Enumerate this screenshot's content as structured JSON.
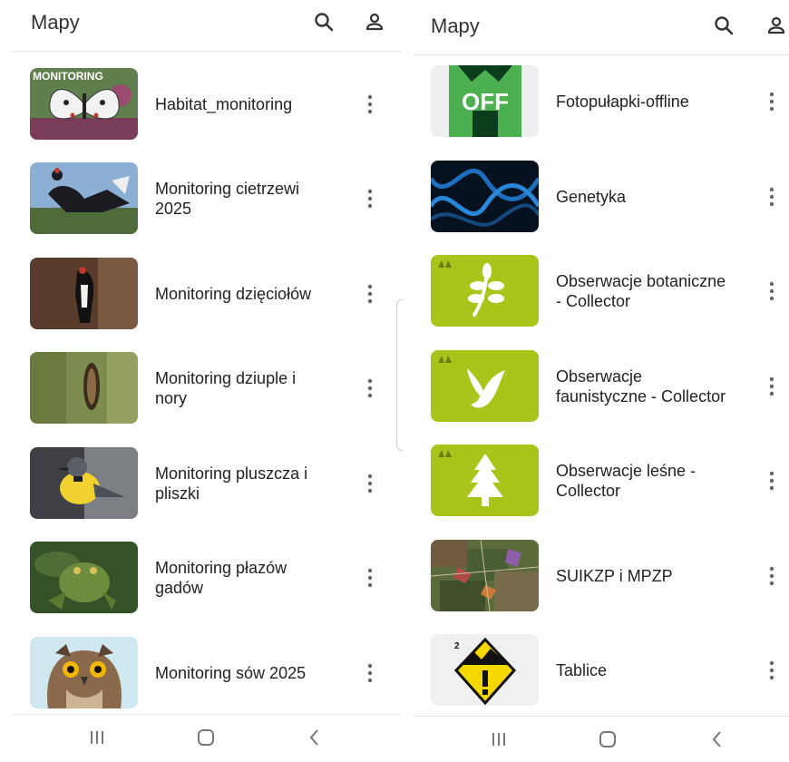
{
  "left": {
    "appbar": {
      "title": "Mapy",
      "search_icon": "search-icon",
      "account_icon": "account-icon"
    },
    "items": [
      {
        "label": "Habitat_monitoring",
        "thumb_text": "MONITORING"
      },
      {
        "label": "Monitoring cietrzewi\n2025"
      },
      {
        "label": "Monitoring dzięciołów"
      },
      {
        "label": "Monitoring dziuple i\nnory"
      },
      {
        "label": "Monitoring pluszcza i\npliszki"
      },
      {
        "label": "Monitoring płazów\ngadów"
      },
      {
        "label": "Monitoring sów 2025"
      }
    ],
    "navbar": {
      "recents_icon": "recents-icon",
      "home_icon": "home-icon",
      "back_icon": "back-icon"
    }
  },
  "right": {
    "appbar": {
      "title": "Mapy",
      "search_icon": "search-icon",
      "account_icon": "account-icon"
    },
    "items": [
      {
        "label": "Fotopułapki-offline",
        "thumb_text": "OFF"
      },
      {
        "label": "Genetyka"
      },
      {
        "label": "Obserwacje botaniczne\n- Collector"
      },
      {
        "label": "Obserwacje\nfaunistyczne - Collector"
      },
      {
        "label": "Obserwacje leśne -\nCollector"
      },
      {
        "label": "SUIKZP i MPZP"
      },
      {
        "label": "Tablice",
        "thumb_text": "2"
      }
    ],
    "navbar": {
      "recents_icon": "recents-icon",
      "home_icon": "home-icon",
      "back_icon": "back-icon"
    }
  },
  "colors": {
    "collector_green": "#a9c41b",
    "off_green": "#4caf50",
    "text": "#222222"
  }
}
